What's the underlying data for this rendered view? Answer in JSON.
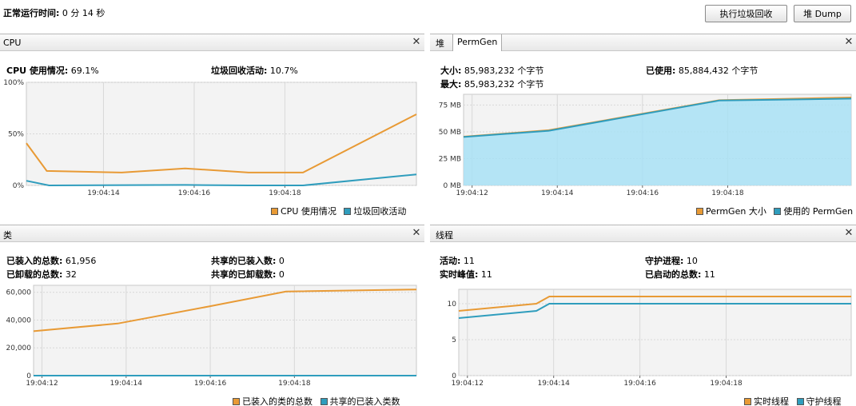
{
  "header": {
    "uptime_label": "正常运行时间:",
    "uptime_value": "0 分 14 秒",
    "gc_button": "执行垃圾回收",
    "dump_button": "堆 Dump"
  },
  "colors": {
    "orange": "#e89a35",
    "teal": "#2f9dbd",
    "heap_fill": "#a8e0f5"
  },
  "cpu_panel": {
    "title": "CPU",
    "cpu_usage_label": "CPU 使用情况:",
    "cpu_usage_value": "69.1%",
    "gc_activity_label": "垃圾回收活动:",
    "gc_activity_value": "10.7%",
    "legend": [
      "CPU 使用情况",
      "垃圾回收活动"
    ]
  },
  "heap_panel": {
    "tabs": [
      "堆",
      "PermGen"
    ],
    "active_tab": "PermGen",
    "size_label": "大小:",
    "size_value": "85,983,232 个字节",
    "used_label": "已使用:",
    "used_value": "85,884,432 个字节",
    "max_label": "最大:",
    "max_value": "85,983,232 个字节",
    "legend": [
      "PermGen 大小",
      "使用的 PermGen"
    ]
  },
  "classes_panel": {
    "title": "类",
    "loaded_label": "已装入的总数:",
    "loaded_value": "61,956",
    "unloaded_label": "已卸载的总数:",
    "unloaded_value": "32",
    "shared_loaded_label": "共享的已装入数:",
    "shared_loaded_value": "0",
    "shared_unloaded_label": "共享的已卸载数:",
    "shared_unloaded_value": "0",
    "legend": [
      "已装入的类的总数",
      "共享的已装入类数"
    ]
  },
  "threads_panel": {
    "title": "线程",
    "live_label": "活动:",
    "live_value": "11",
    "peak_label": "实时峰值:",
    "peak_value": "11",
    "daemon_label": "守护进程:",
    "daemon_value": "10",
    "started_label": "已启动的总数:",
    "started_value": "11",
    "legend": [
      "实时线程",
      "守护线程"
    ]
  },
  "chart_data": [
    {
      "type": "line",
      "id": "cpu",
      "ylim": [
        0,
        100
      ],
      "yticks": [
        "0%",
        "50%",
        "100%"
      ],
      "xlim": [
        12.3,
        20.9
      ],
      "xticks": [
        "19:04:14",
        "19:04:16",
        "19:04:18"
      ],
      "series": [
        {
          "name": "CPU 使用情况",
          "color": "#e89a35",
          "x": [
            12.3,
            12.75,
            14.4,
            15.8,
            17.2,
            18.4,
            20.9
          ],
          "y": [
            41,
            14,
            12.5,
            16.5,
            12.5,
            12.5,
            69
          ]
        },
        {
          "name": "垃圾回收活动",
          "color": "#2f9dbd",
          "x": [
            12.3,
            12.8,
            15.8,
            17.2,
            18.4,
            20.9
          ],
          "y": [
            4.5,
            0,
            0.5,
            0,
            0,
            10.7
          ]
        }
      ]
    },
    {
      "type": "area",
      "id": "permgen",
      "ylim": [
        0,
        85
      ],
      "yticks": [
        "0 MB",
        "25 MB",
        "50 MB",
        "75 MB"
      ],
      "xlim": [
        11.8,
        20.9
      ],
      "xticks": [
        "19:04:12",
        "19:04:14",
        "19:04:16",
        "19:04:18"
      ],
      "series": [
        {
          "name": "PermGen 大小",
          "color": "#e89a35",
          "x": [
            11.8,
            13.8,
            17.8,
            20.9
          ],
          "y": [
            45.5,
            51.5,
            79.5,
            82
          ]
        },
        {
          "name": "使用的 PermGen",
          "color": "#2f9dbd",
          "x": [
            11.8,
            13.8,
            17.8,
            20.9
          ],
          "y": [
            45.2,
            51,
            79.2,
            81
          ]
        }
      ]
    },
    {
      "type": "line",
      "id": "classes",
      "ylim": [
        0,
        65000
      ],
      "yticks": [
        "0",
        "20,000",
        "40,000",
        "60,000"
      ],
      "xlim": [
        11.8,
        20.9
      ],
      "xticks": [
        "19:04:12",
        "19:04:14",
        "19:04:16",
        "19:04:18"
      ],
      "series": [
        {
          "name": "已装入的类的总数",
          "color": "#e89a35",
          "x": [
            11.8,
            13.8,
            16.0,
            17.8,
            20.9
          ],
          "y": [
            32000,
            37500,
            50000,
            60500,
            62000
          ]
        },
        {
          "name": "共享的已装入类数",
          "color": "#2f9dbd",
          "x": [
            11.8,
            20.9
          ],
          "y": [
            0,
            0
          ]
        }
      ]
    },
    {
      "type": "line",
      "id": "threads",
      "ylim": [
        0,
        12
      ],
      "yticks": [
        "0",
        "5",
        "10"
      ],
      "xlim": [
        11.8,
        20.9
      ],
      "xticks": [
        "19:04:12",
        "19:04:14",
        "19:04:16",
        "19:04:18"
      ],
      "series": [
        {
          "name": "实时线程",
          "color": "#e89a35",
          "x": [
            11.8,
            13.6,
            13.9,
            20.9
          ],
          "y": [
            9,
            10,
            11,
            11
          ]
        },
        {
          "name": "守护线程",
          "color": "#2f9dbd",
          "x": [
            11.8,
            13.6,
            13.9,
            20.9
          ],
          "y": [
            8,
            9,
            10,
            10
          ]
        }
      ]
    }
  ]
}
